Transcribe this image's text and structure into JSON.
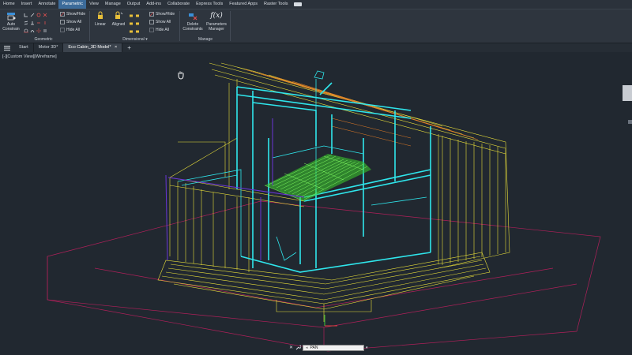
{
  "menu": [
    "Home",
    "Insert",
    "Annotate",
    "Parametric",
    "View",
    "Manage",
    "Output",
    "Add-ins",
    "Collaborate",
    "Express Tools",
    "Featured Apps",
    "Raster Tools"
  ],
  "menu_active_index": 3,
  "ribbon": {
    "auto_constrain": "Auto Constrain",
    "geometric_label": "Geometric",
    "geometric_show_hide": "Show/Hide",
    "geometric_show_all": "Show All",
    "geometric_hide_all": "Hide All",
    "linear": "Linear",
    "aligned": "Aligned",
    "dimensional_label": "Dimensional",
    "dimensional_show_hide": "Show/Hide",
    "dimensional_show_all": "Show All",
    "dimensional_hide_all": "Hide All",
    "delete_constraints": "Delete Constraints",
    "parameters_manager": "Parameters Manager",
    "manage_label": "Manage",
    "fx": "f(x)"
  },
  "tabs": [
    "Start",
    "Motor 3D*",
    "Eco Cabin_3D Model*"
  ],
  "active_tab_index": 2,
  "viewport_label": "[-][Custom View][Wireframe]",
  "command": {
    "value": "PAN"
  },
  "colors": {
    "cyan": "#2fe6ec",
    "yellow": "#e8de3a",
    "green": "#5cf24a",
    "purple": "#6a35d8",
    "magenta": "#b0205a",
    "orange": "#e07a26",
    "bg": "#212830"
  }
}
